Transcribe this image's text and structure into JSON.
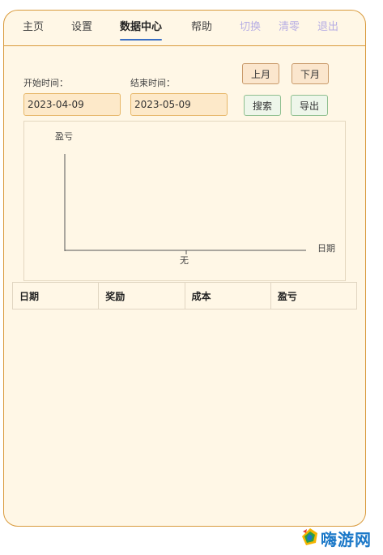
{
  "nav": {
    "items": [
      {
        "label": "主页"
      },
      {
        "label": "设置"
      },
      {
        "label": "数据中心"
      },
      {
        "label": "帮助"
      },
      {
        "label": "切换"
      },
      {
        "label": "清零"
      },
      {
        "label": "退出"
      }
    ],
    "active_index": 2
  },
  "filters": {
    "start_label": "开始时间：",
    "start_value": "2023-04-09",
    "end_label": "结束时间：",
    "end_value": "2023-05-09",
    "prev_month_label": "上月",
    "next_month_label": "下月",
    "search_label": "搜索",
    "export_label": "导出"
  },
  "chart_data": {
    "type": "line",
    "ylabel": "盈亏",
    "xlabel": "日期",
    "categories": [
      "无"
    ],
    "series": []
  },
  "table": {
    "headers": [
      "日期",
      "奖励",
      "成本",
      "盈亏"
    ],
    "rows": []
  },
  "watermark": {
    "text": "嗨游网"
  },
  "colors": {
    "card_bg": "#fff7e6",
    "card_border": "#d99a3c",
    "active_underline": "#3a6fc4",
    "muted_nav": "#b7aee4",
    "input_bg": "#fde9c9"
  }
}
